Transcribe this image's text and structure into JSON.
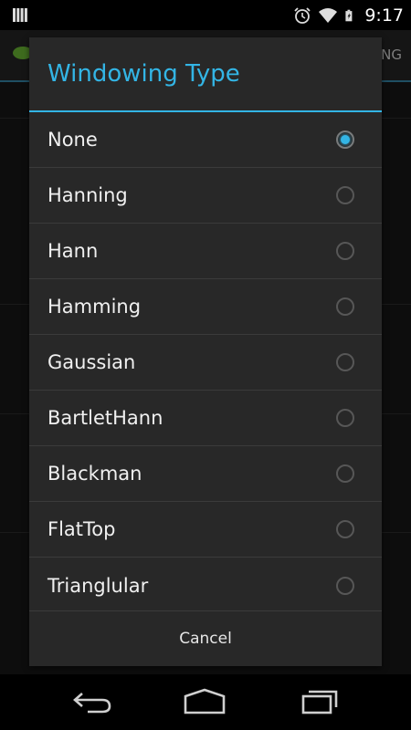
{
  "status_bar": {
    "time": "9:17",
    "icons": [
      "signal-bars-icon",
      "alarm-clock-icon",
      "wifi-icon",
      "battery-charging-icon"
    ]
  },
  "app": {
    "tab_fragment": "NG"
  },
  "dialog": {
    "title": "Windowing Type",
    "selected_index": 0,
    "options": [
      {
        "label": "None",
        "checked": true
      },
      {
        "label": "Hanning",
        "checked": false
      },
      {
        "label": "Hann",
        "checked": false
      },
      {
        "label": "Hamming",
        "checked": false
      },
      {
        "label": "Gaussian",
        "checked": false
      },
      {
        "label": "BartletHann",
        "checked": false
      },
      {
        "label": "Blackman",
        "checked": false
      },
      {
        "label": "FlatTop",
        "checked": false
      },
      {
        "label": "Trianglular",
        "checked": false
      }
    ],
    "cancel_label": "Cancel"
  },
  "nav_bar": {
    "buttons": [
      "back-icon",
      "home-icon",
      "recents-icon"
    ]
  },
  "colors": {
    "accent": "#33b5e5",
    "dialog_bg": "#282828"
  }
}
